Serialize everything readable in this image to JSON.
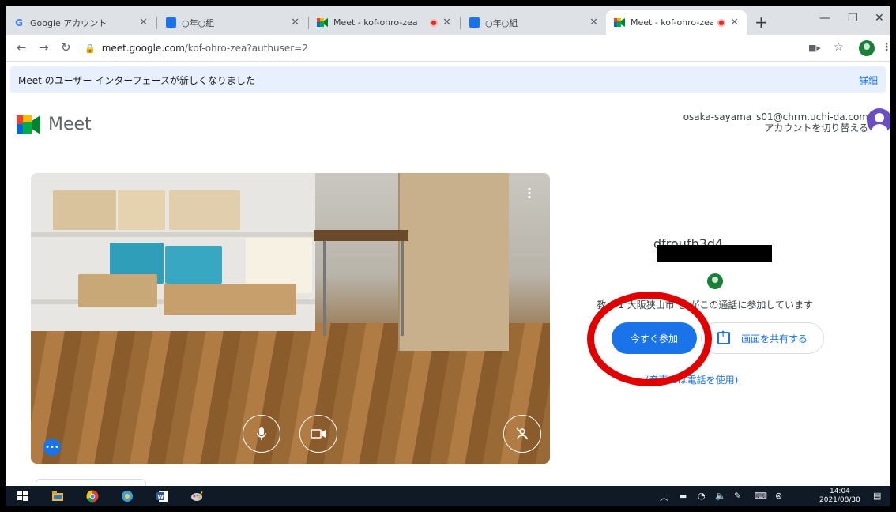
{
  "browser": {
    "tabs": [
      {
        "title": "Google アカウント",
        "favicon": "google-g-icon",
        "active": false,
        "recording": false
      },
      {
        "title": "○年○組",
        "favicon": "classroom-icon",
        "active": false,
        "recording": false
      },
      {
        "title": "Meet - kof-ohro-zea",
        "favicon": "meet-icon",
        "active": false,
        "recording": true
      },
      {
        "title": "○年○組",
        "favicon": "classroom-icon",
        "active": false,
        "recording": false
      },
      {
        "title": "Meet - kof-ohro-zea",
        "favicon": "meet-icon",
        "active": true,
        "recording": true
      }
    ],
    "url_host": "meet.google.com",
    "url_path": "/kof-ohro-zea?authuser=2"
  },
  "banner": {
    "message": "Meet のユーザー インターフェースが新しくなりました",
    "link": "詳細"
  },
  "app": {
    "name": "Meet"
  },
  "account": {
    "email": "osaka-sayama_s01@chrm.uchi-da.com",
    "switch_label": "アカウントを切り替える"
  },
  "join_panel": {
    "meeting_name_partial": "dfroufh3d4",
    "participants_text": "教  0 1 大阪狭山市 さ  がこの通話に参加しています",
    "join_button": "今すぐ参加",
    "share_button": "画面を共有する",
    "phone_link": "  (音声には電話を使用)"
  },
  "taskbar": {
    "time": "14:04",
    "date": "2021/08/30"
  },
  "colors": {
    "accent": "#1a73e8",
    "annotation_ring": "#e10000",
    "recording": "#d93025"
  }
}
